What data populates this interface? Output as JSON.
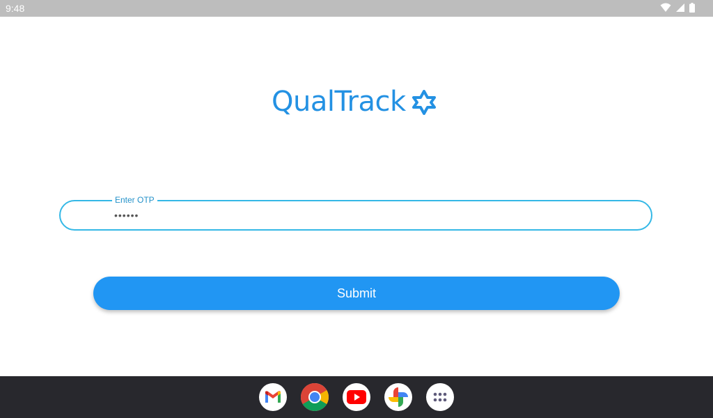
{
  "status_bar": {
    "time": "9:48",
    "icons": [
      "wifi-icon",
      "signal-icon",
      "battery-icon"
    ]
  },
  "app": {
    "logo_text": "QualTrack",
    "logo_icon": "gear-icon",
    "otp": {
      "label": "Enter OTP",
      "value": "123456"
    },
    "submit_label": "Submit"
  },
  "taskbar": {
    "apps": [
      "gmail-icon",
      "chrome-icon",
      "youtube-icon",
      "photos-icon",
      "app-drawer-icon"
    ]
  },
  "colors": {
    "brand": "#2391e3",
    "accent": "#2196f3",
    "field_border": "#34b8e6",
    "taskbar": "#28282d",
    "status_bar": "#bdbdbd"
  }
}
